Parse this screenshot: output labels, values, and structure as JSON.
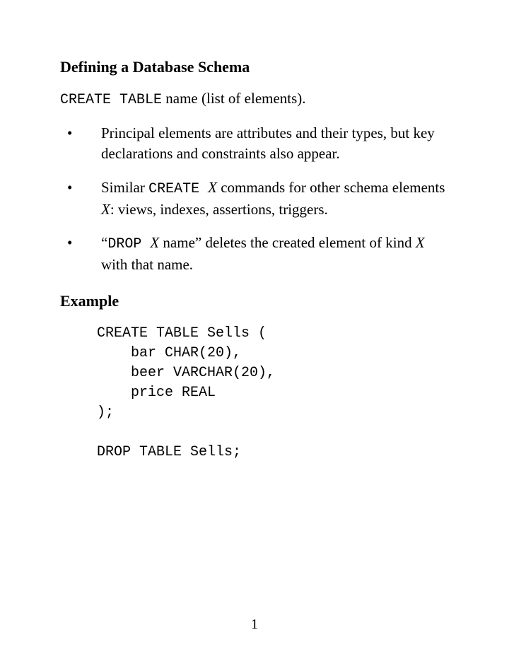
{
  "heading1": "Defining a Database Schema",
  "intro": {
    "code": "CREATE TABLE",
    "rest": " name (list of elements)."
  },
  "bullets": [
    {
      "parts": [
        {
          "text": "Principal elements are attributes and their types, but key declarations and constraints also appear."
        }
      ]
    },
    {
      "parts": [
        {
          "text": "Similar "
        },
        {
          "tt": "CREATE "
        },
        {
          "math": "X"
        },
        {
          "text": " commands for other schema elements "
        },
        {
          "math": "X"
        },
        {
          "text": ": views, indexes, assertions, triggers."
        }
      ]
    },
    {
      "parts": [
        {
          "text": "“"
        },
        {
          "tt": "DROP "
        },
        {
          "math": "X"
        },
        {
          "text": " name” deletes the created element of kind "
        },
        {
          "math": "X"
        },
        {
          "text": " with that name."
        }
      ]
    }
  ],
  "heading2": "Example",
  "code_block": "CREATE TABLE Sells (\n    bar CHAR(20),\n    beer VARCHAR(20),\n    price REAL\n);\n\nDROP TABLE Sells;",
  "page_number": "1"
}
